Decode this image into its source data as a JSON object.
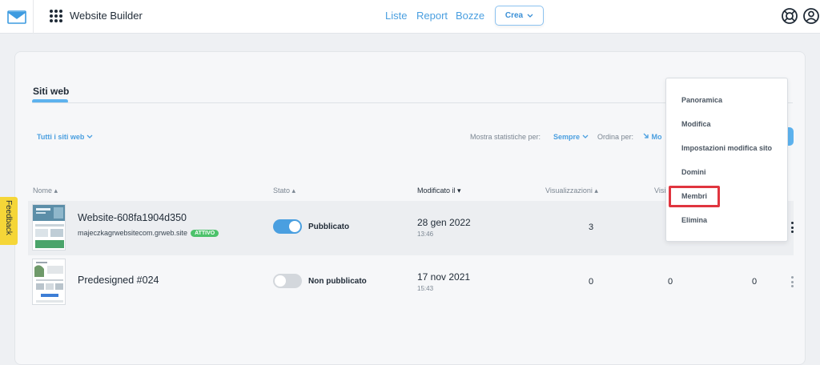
{
  "header": {
    "app_title": "Website Builder",
    "nav": [
      "Liste",
      "Report",
      "Bozze"
    ],
    "create_label": "Crea"
  },
  "page": {
    "tab": "Siti web",
    "filter_label": "Tutti i siti web",
    "stats_label": "Mostra statistiche per:",
    "stats_value": "Sempre",
    "order_label": "Ordina per:",
    "order_value": "Mo"
  },
  "table": {
    "columns": {
      "name": "Nome",
      "status": "Stato",
      "modified": "Modificato il",
      "views": "Visualizzazioni",
      "visits": "Visi"
    },
    "rows": [
      {
        "name": "Website-608fa1904d350",
        "url": "majeczkagrwebsitecom.grweb.site",
        "badge": "ATTIVO",
        "status": "Pubblicato",
        "published": true,
        "date": "28 gen 2022",
        "time": "13:46",
        "views": "3"
      },
      {
        "name": "Predesigned #024",
        "status": "Non pubblicato",
        "published": false,
        "date": "17 nov 2021",
        "time": "15:43",
        "views": "0",
        "visits": "0",
        "extra": "0"
      }
    ]
  },
  "menu": {
    "items": [
      "Panoramica",
      "Modifica",
      "Impostazioni modifica sito",
      "Domini",
      "Membri",
      "Elimina"
    ]
  },
  "feedback": "Feedback",
  "colors": {
    "accent": "#4a9fe0",
    "highlight": "#e0353f",
    "badge": "#4cc26b",
    "feedback": "#f5d638"
  }
}
